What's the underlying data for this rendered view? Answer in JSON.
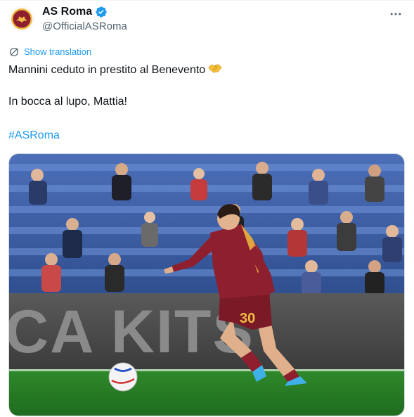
{
  "author": {
    "display_name": "AS Roma",
    "handle": "@OfficialASRoma",
    "verified": true,
    "avatar_icon": "as-roma-crest-icon"
  },
  "translate": {
    "label": "Show translation",
    "icon": "translate-icon"
  },
  "tweet": {
    "line1": "Mannini ceduto in prestito al Benevento",
    "line1_emoji": "handshake-icon",
    "line2": "In bocca al lupo, Mattia!",
    "hashtag": "#ASRoma"
  },
  "media": {
    "banner_text": "CA KITS",
    "shirt_number": "30",
    "description_icon": "football-player-photo"
  },
  "colors": {
    "accent": "#1d9bf0",
    "text": "#0f1419",
    "muted": "#536471",
    "roma_red": "#8e1f2f",
    "roma_gold": "#f0bc42"
  }
}
